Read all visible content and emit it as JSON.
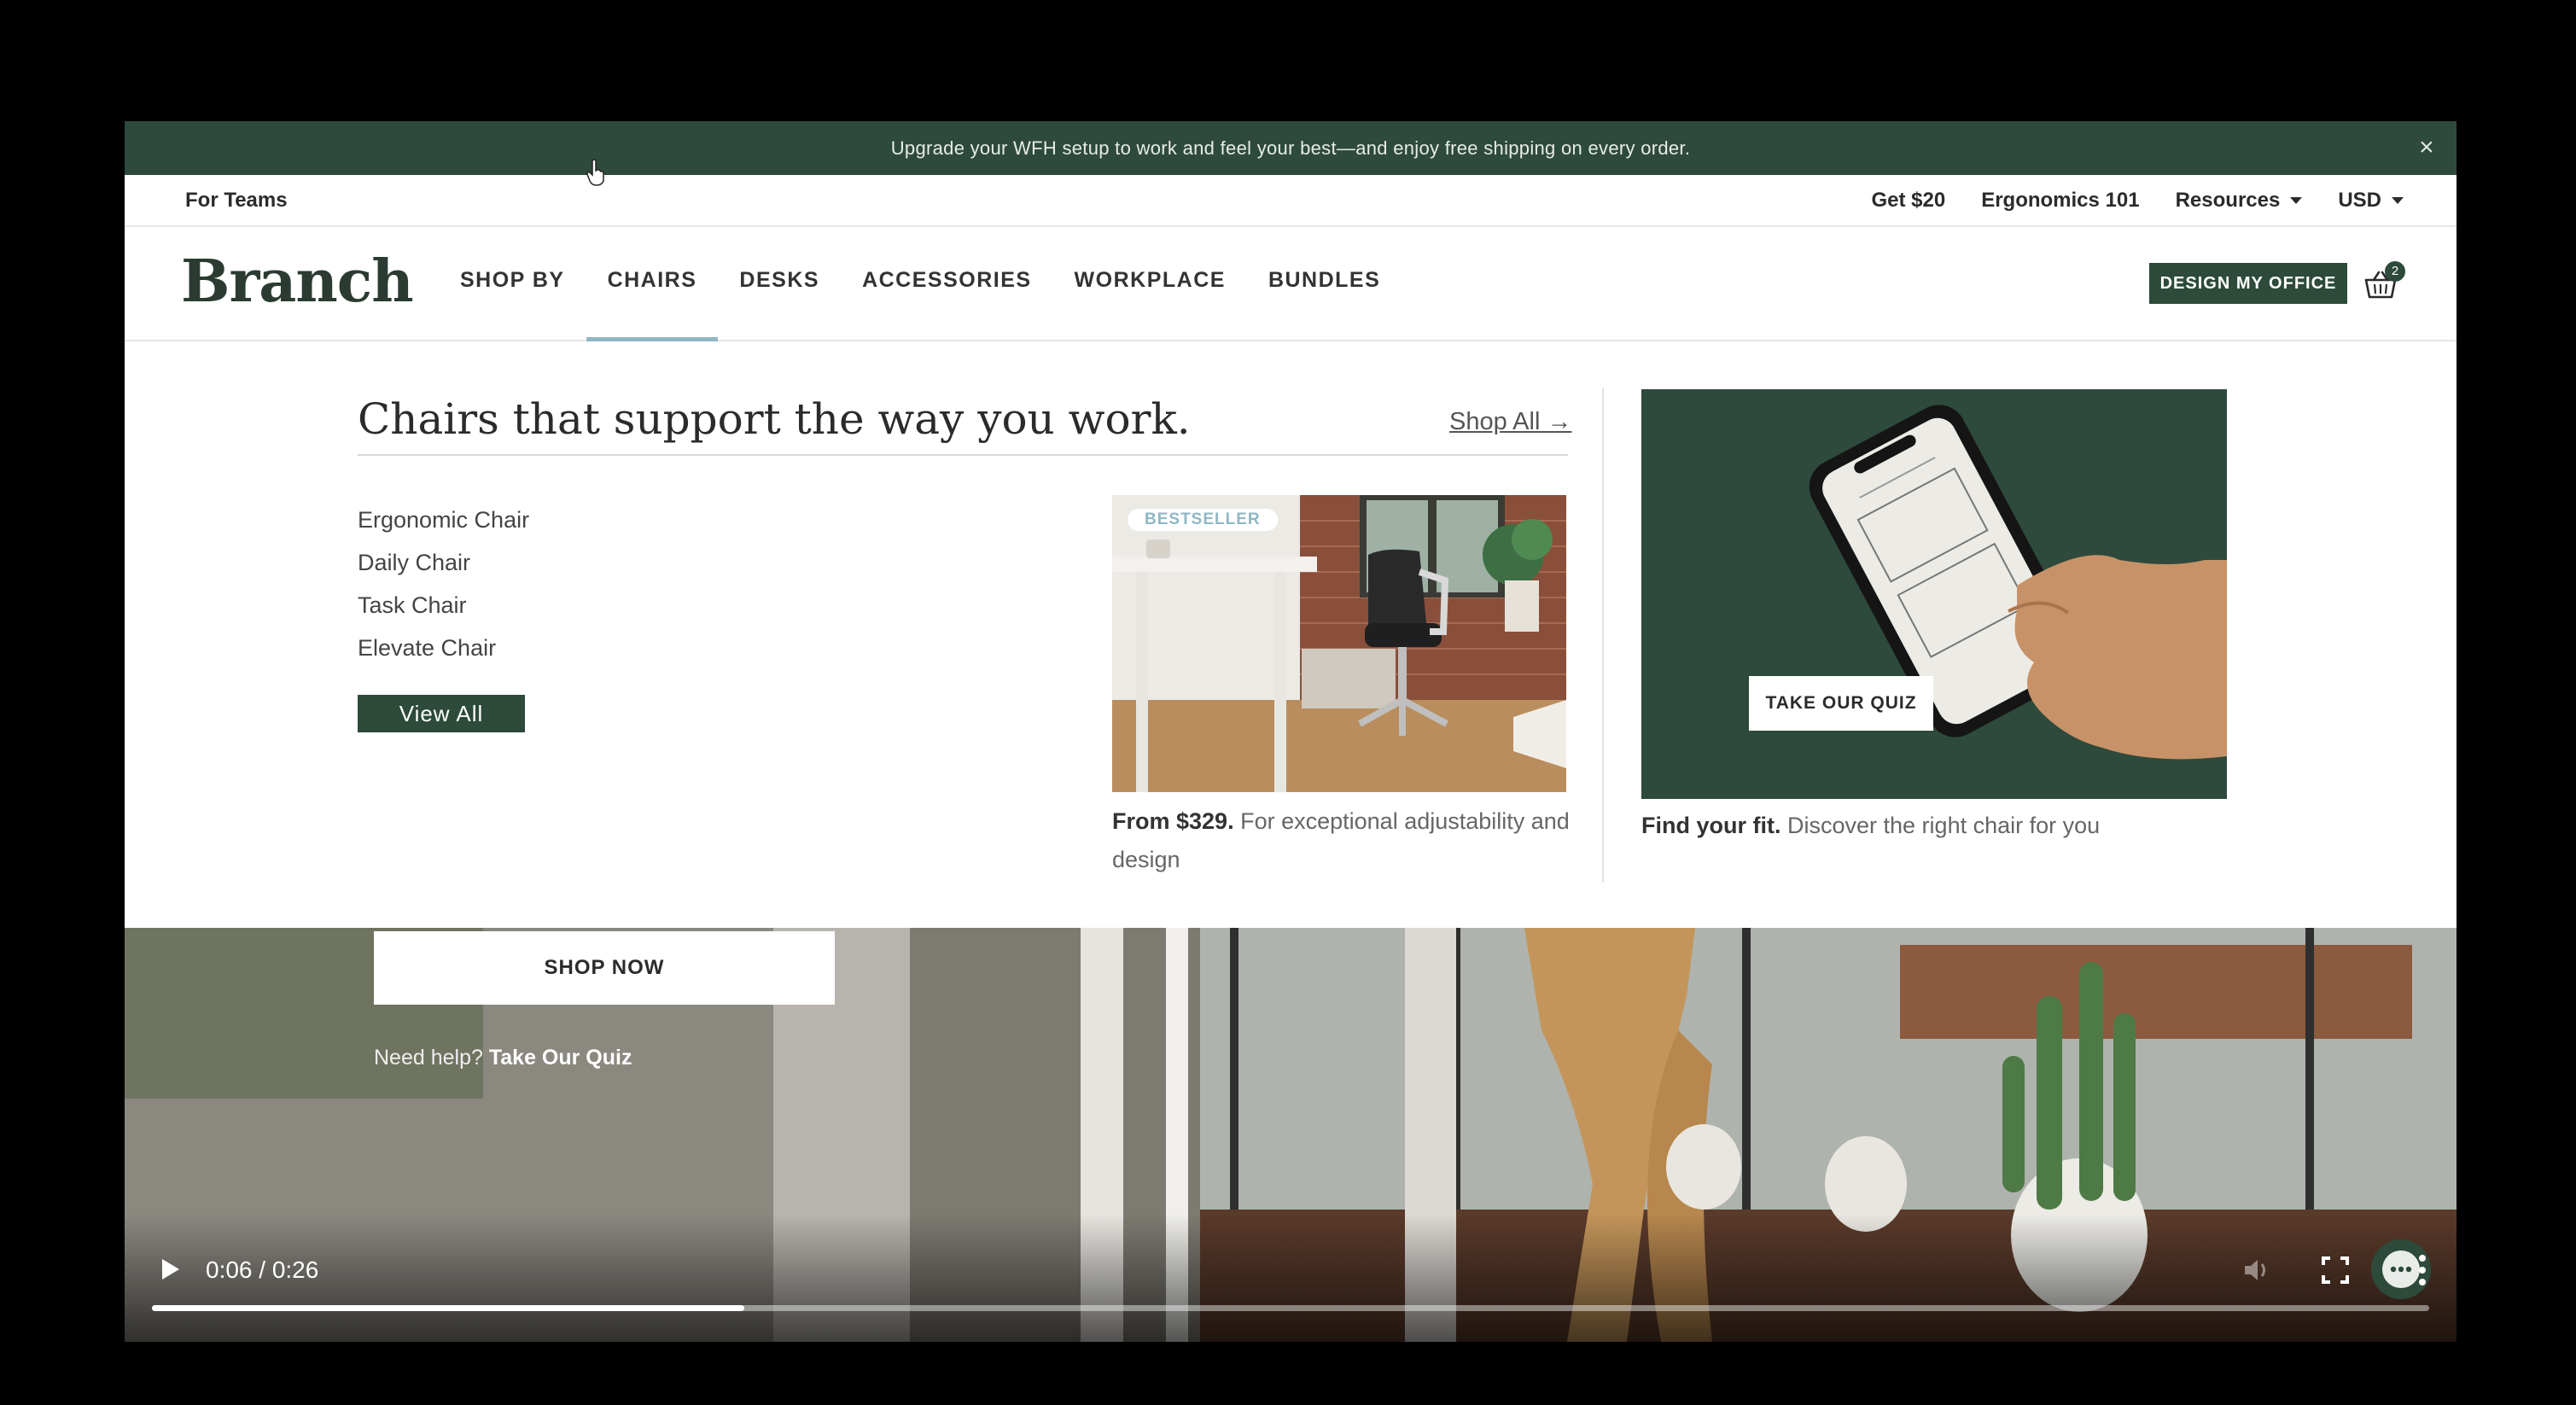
{
  "announcement": {
    "text": "Upgrade your WFH setup to work and feel your best—and enjoy free shipping on every order.",
    "close_label": "×"
  },
  "utility": {
    "for_teams": "For Teams",
    "get20": "Get $20",
    "ergonomics": "Ergonomics 101",
    "resources": "Resources",
    "currency": "USD"
  },
  "nav": {
    "logo": "Branch",
    "items": [
      {
        "label": "SHOP BY"
      },
      {
        "label": "CHAIRS"
      },
      {
        "label": "DESKS"
      },
      {
        "label": "ACCESSORIES"
      },
      {
        "label": "WORKPLACE"
      },
      {
        "label": "BUNDLES"
      }
    ],
    "active_item": "CHAIRS",
    "design_button": "DESIGN MY OFFICE",
    "cart_count": "2"
  },
  "dropdown": {
    "title": "Chairs that support the way you work.",
    "shop_all": "Shop All →",
    "chairs": [
      {
        "label": "Ergonomic Chair"
      },
      {
        "label": "Daily Chair"
      },
      {
        "label": "Task Chair"
      },
      {
        "label": "Elevate Chair"
      }
    ],
    "view_all": "View All",
    "promo": {
      "badge": "BESTSELLER",
      "price": "From $329.",
      "description": "For exceptional adjustability and design"
    },
    "quiz": {
      "button": "TAKE OUR QUIZ",
      "caption_bold": "Find your fit.",
      "caption": "Discover the right chair for you"
    }
  },
  "hero": {
    "shop_now": "SHOP NOW",
    "need_help": "Need help?",
    "take_quiz": "Take Our Quiz"
  },
  "video": {
    "time": "0:06 / 0:26",
    "progress": 0.26
  },
  "colors": {
    "brand_green": "#2e4a3c",
    "accent_blue": "#8fb7c4"
  }
}
